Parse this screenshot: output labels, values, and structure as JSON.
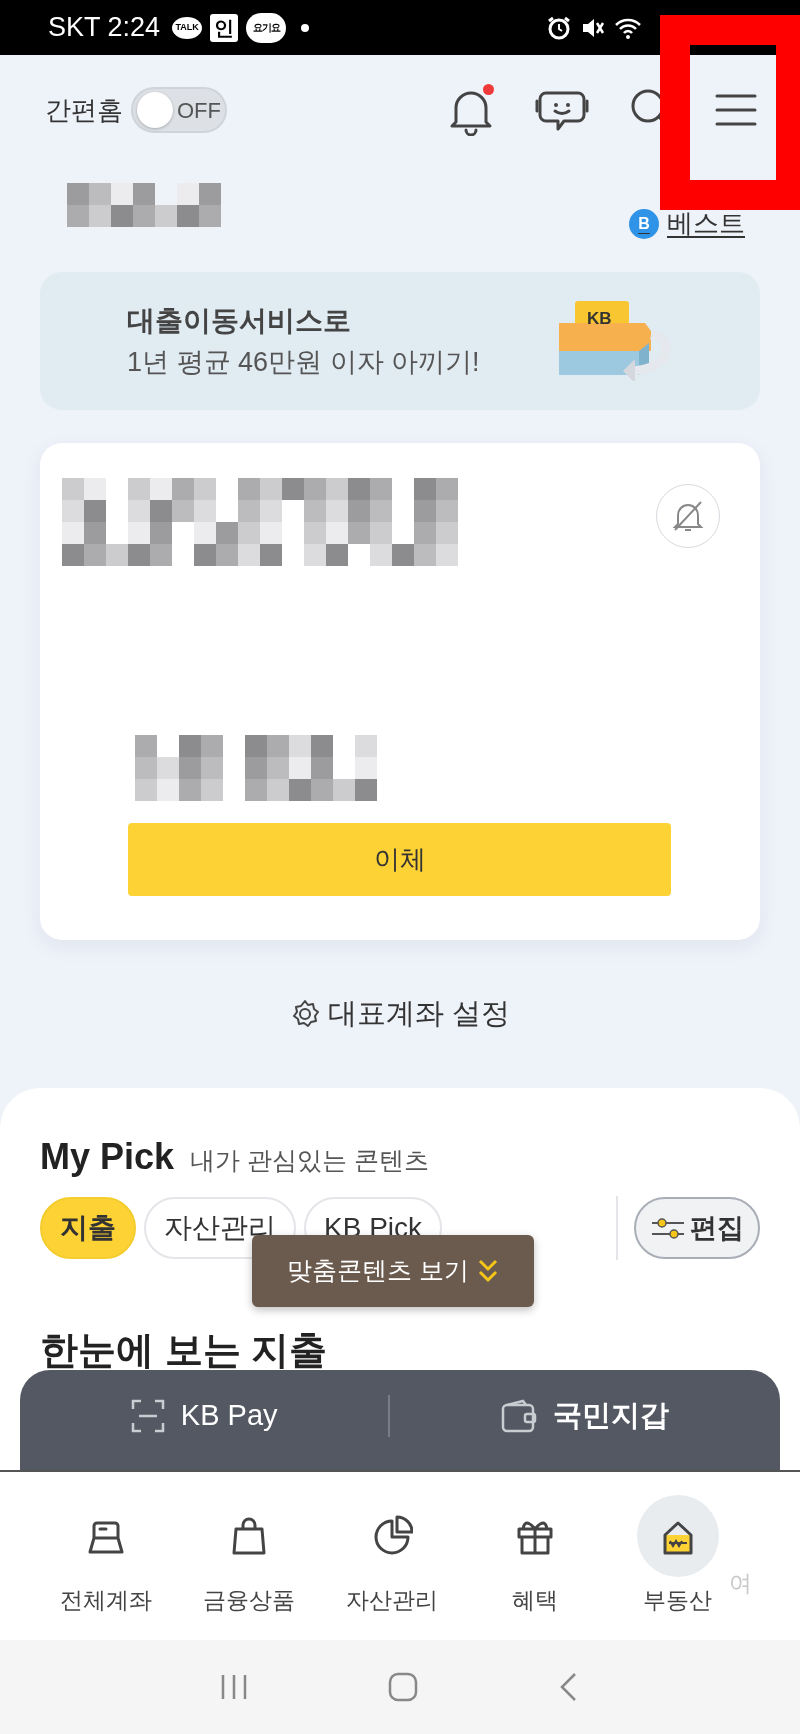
{
  "status_bar": {
    "carrier_time": "SKT 2:24",
    "notifications": [
      {
        "kind": "bubble",
        "text": "TALK"
      },
      {
        "kind": "square",
        "text": "인"
      },
      {
        "kind": "circle",
        "text": "요기요"
      }
    ]
  },
  "header": {
    "quick_home": {
      "label": "간편홈",
      "on": false,
      "state_text": "OFF"
    },
    "notification_dot": true
  },
  "best_link": {
    "badge": "B",
    "label": "베스트"
  },
  "banner": {
    "title": "대출이동서비스로",
    "subtitle": "1년 평균 46만원 이자 아끼기!",
    "logo": "KB"
  },
  "account_card": {
    "alerts_on": false,
    "transfer_button": "이체"
  },
  "primary_account_setting": "대표계좌 설정",
  "my_pick": {
    "title": "My Pick",
    "subtitle": "내가 관심있는 콘텐츠",
    "chips": [
      {
        "label": "지출",
        "selected": true
      },
      {
        "label": "자산관리",
        "selected": false
      },
      {
        "label": "KB Pick",
        "selected": false
      }
    ],
    "edit_button": "편집",
    "tooltip": "맞춤콘텐츠 보기",
    "section_heading": "한눈에 보는 지출"
  },
  "quick_bar": [
    {
      "kind": "scan",
      "label": "KB Pay"
    },
    {
      "kind": "wallet",
      "label": "국민지갑"
    }
  ],
  "bottom_nav": [
    {
      "kind": "card",
      "label": "전체계좌",
      "highlighted": false
    },
    {
      "kind": "bag",
      "label": "금융상품",
      "highlighted": false
    },
    {
      "kind": "pie",
      "label": "자산관리",
      "highlighted": false
    },
    {
      "kind": "gift",
      "label": "혜택",
      "highlighted": false
    },
    {
      "kind": "house",
      "label": "부동산",
      "highlighted": true
    },
    {
      "kind": "cut",
      "label": "여",
      "highlighted": false
    }
  ],
  "annotation": {
    "kind": "frame"
  }
}
